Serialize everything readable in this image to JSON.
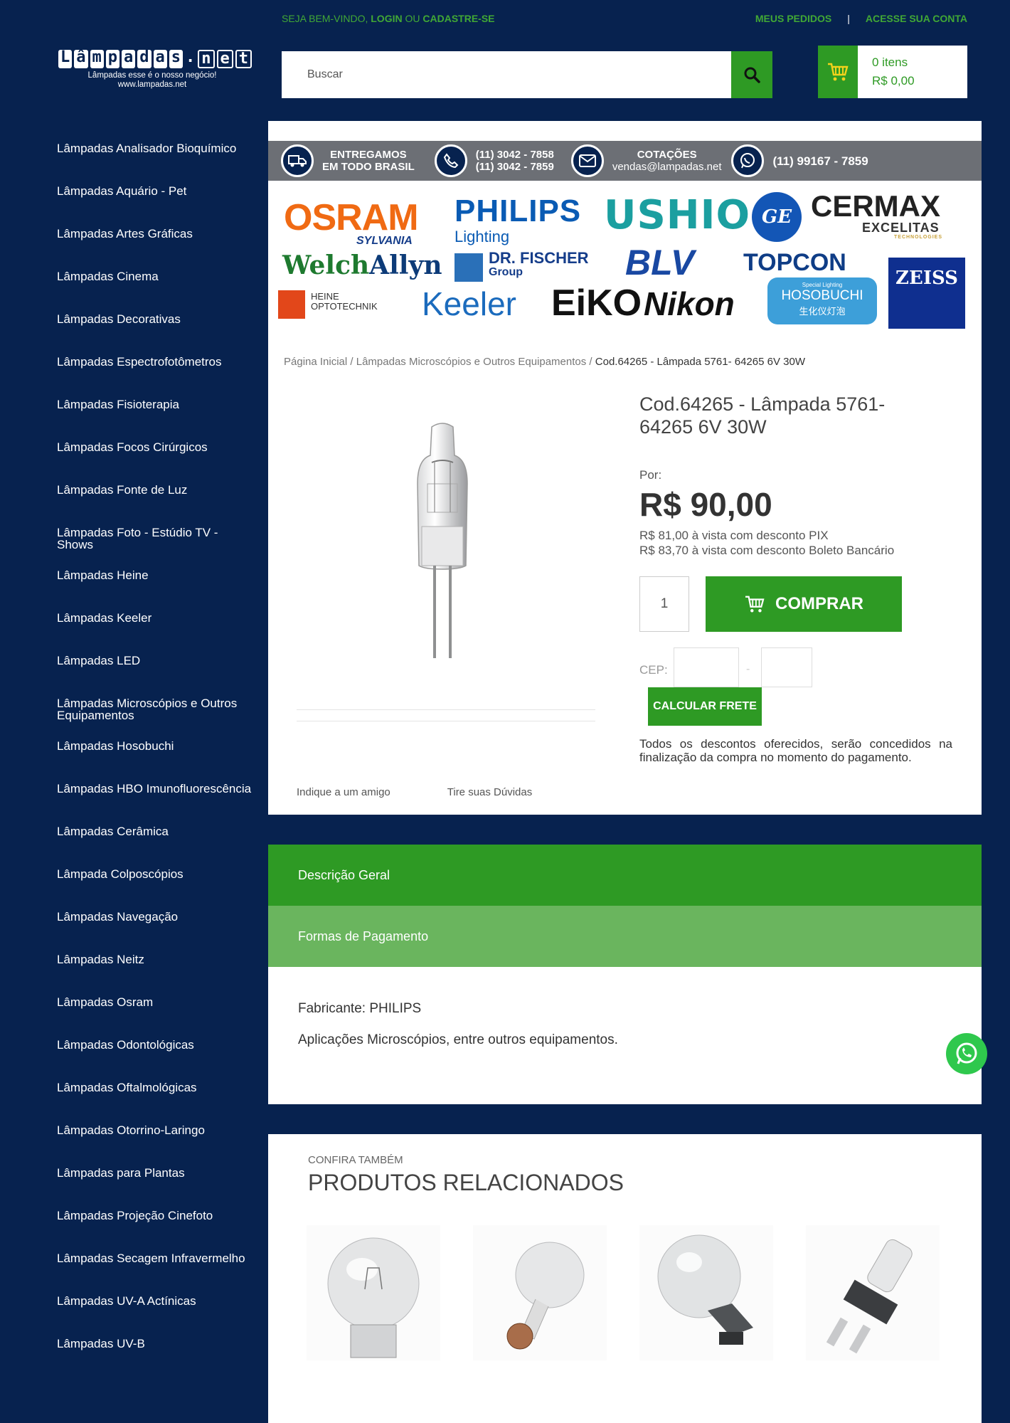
{
  "topbar": {
    "welcome_prefix": "SEJA BEM-VINDO, ",
    "login": "LOGIN",
    "or": " OU ",
    "register": "CADASTRE-SE",
    "orders": "MEUS PEDIDOS",
    "separator": "|",
    "account": "ACESSE SUA CONTA"
  },
  "logo": {
    "letters": [
      "L",
      "â",
      "m",
      "p",
      "a",
      "d",
      "a",
      "s",
      ".",
      "n",
      "e",
      "t"
    ],
    "tagline": "Lâmpadas esse é o nosso negócio!",
    "url": "www.lampadas.net"
  },
  "search": {
    "placeholder": "Buscar"
  },
  "cart": {
    "items": "0 itens",
    "total": "R$ 0,00"
  },
  "sidebar": {
    "items": [
      "Lâmpadas Analisador Bioquímico",
      "Lâmpadas Aquário - Pet",
      "Lâmpadas Artes Gráficas",
      "Lâmpadas Cinema",
      "Lâmpadas Decorativas",
      "Lâmpadas Espectrofotômetros",
      "Lâmpadas Fisioterapia",
      "Lâmpadas Focos Cirúrgicos",
      "Lâmpadas Fonte de Luz",
      "Lâmpadas Foto - Estúdio TV - Shows",
      "Lâmpadas Heine",
      "Lâmpadas Keeler",
      "Lâmpadas LED",
      "Lâmpadas Microscópios e Outros Equipamentos",
      "Lâmpadas Hosobuchi",
      "Lâmpadas HBO Imunofluorescência",
      "Lâmpadas Cerâmica",
      "Lâmpada Colposcópios",
      "Lâmpadas Navegação",
      "Lâmpadas Neitz",
      "Lâmpadas Osram",
      "Lâmpadas Odontológicas",
      "Lâmpadas Oftalmológicas",
      "Lâmpadas Otorrino-Laringo",
      "Lâmpadas para Plantas",
      "Lâmpadas Projeção Cinefoto",
      "Lâmpadas Secagem Infravermelho",
      "Lâmpadas UV-A Actínicas",
      "Lâmpadas UV-B"
    ]
  },
  "contact": {
    "delivery_1": "ENTREGAMOS",
    "delivery_2": "EM TODO BRASIL",
    "phone_1": "(11) 3042 - 7858",
    "phone_2": "(11) 3042 - 7859",
    "quotes_1": "COTAÇÕES",
    "quotes_2": "vendas@lampadas.net",
    "whatsapp": "(11) 99167 - 7859"
  },
  "brands": {
    "osram": "OSRAM",
    "sylvania": "SYLVANIA",
    "philips": "PHILIPS",
    "lighting": "Lighting",
    "ushio": "USHIO",
    "ge": "GE",
    "cermax": "CERMAX",
    "excelitas": "EXCELITAS",
    "technologies": "TECHNOLOGIES",
    "welch": "Welch",
    "allyn": "Allyn",
    "drfischer": "DR. FISCHER",
    "group": "Group",
    "blv": "BLV",
    "topcon": "TOPCON",
    "zeiss": "ZEISS",
    "heine1": "HEINE",
    "heine2": "OPTOTECHNIK",
    "keeler": "Keeler",
    "eiko": "EiKO",
    "nikon": "Nikon",
    "hoso_small": "Special Lighting",
    "hoso": "HOSOBUCHI",
    "hoso_cn": "生化仪灯泡"
  },
  "breadcrumb": {
    "home": "Página Inicial",
    "sep": " / ",
    "category": "Lâmpadas Microscópios e Outros Equipamentos",
    "current": "Cod.64265 - Lâmpada 5761- 64265 6V 30W"
  },
  "product": {
    "title": "Cod.64265 - Lâmpada 5761- 64265 6V 30W",
    "por": "Por:",
    "price": "R$ 90,00",
    "pix": "R$ 81,00 à vista com desconto PIX",
    "boleto": "R$ 83,70 à vista com desconto Boleto Bancário",
    "quantity": "1",
    "buy": "COMPRAR",
    "cep_label": "CEP:",
    "cep_dash": "-",
    "freight": "CALCULAR FRETE",
    "note": "Todos os descontos oferecidos, serão concedidos na finalização da compra no momento do pagamento.",
    "indicate": "Indique a um amigo",
    "questions": "Tire suas Dúvidas"
  },
  "tabs": {
    "description": "Descrição Geral",
    "payment": "Formas de Pagamento"
  },
  "description": {
    "manufacturer": "Fabricante: PHILIPS",
    "applications": "Aplicações Microscópios, entre outros equipamentos."
  },
  "related": {
    "kicker": "CONFIRA TAMBÉM",
    "title": "PRODUTOS RELACIONADOS"
  },
  "colors": {
    "navy": "#07224f",
    "green": "#2e9a24",
    "light_green": "#6ab55e",
    "gray_bar": "#6c6f75"
  }
}
